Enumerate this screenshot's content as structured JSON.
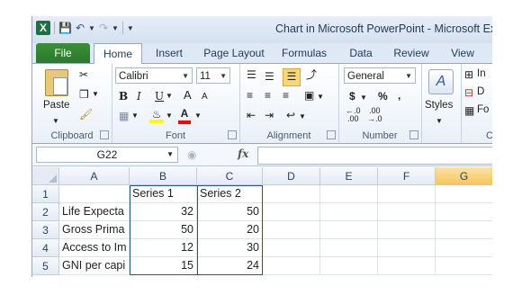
{
  "window": {
    "title": "Chart in Microsoft PowerPoint - Microsoft Excel",
    "app_logo": "X"
  },
  "quick_access": {
    "save_icon": "save-icon",
    "undo_icon": "undo-icon",
    "redo_icon": "redo-icon",
    "customize_icon": "customize-qat-icon"
  },
  "tabs": [
    {
      "label": "File"
    },
    {
      "label": "Home"
    },
    {
      "label": "Insert"
    },
    {
      "label": "Page Layout"
    },
    {
      "label": "Formulas"
    },
    {
      "label": "Data"
    },
    {
      "label": "Review"
    },
    {
      "label": "View"
    }
  ],
  "ribbon": {
    "clipboard": {
      "label": "Clipboard",
      "paste": "Paste"
    },
    "font": {
      "label": "Font",
      "name": "Calibri",
      "size": "11",
      "bold": "B",
      "italic": "I",
      "underline": "U",
      "grow": "A",
      "shrink": "A",
      "color_letter": "A",
      "fill_color": "#ffff00",
      "font_color": "#ff0000"
    },
    "alignment": {
      "label": "Alignment"
    },
    "number": {
      "label": "Number",
      "format": "General",
      "currency": "$",
      "percent": "%",
      "comma": ","
    },
    "styles": {
      "label": "Styles"
    },
    "cells": {
      "insert": "In",
      "delete": "D",
      "format": "Fo",
      "label": "C"
    }
  },
  "formula_bar": {
    "name_box": "G22",
    "fx": "fx",
    "formula": ""
  },
  "sheet": {
    "columns": [
      "A",
      "B",
      "C",
      "D",
      "E",
      "F",
      "G"
    ],
    "selected_column": "G",
    "rows": [
      {
        "num": "1",
        "a": "",
        "b": "Series 1",
        "c": "Series 2"
      },
      {
        "num": "2",
        "a": "Life Expecta",
        "b": "32",
        "c": "50"
      },
      {
        "num": "3",
        "a": "Gross Prima",
        "b": "50",
        "c": "20"
      },
      {
        "num": "4",
        "a": "Access to Im",
        "b": "12",
        "c": "30"
      },
      {
        "num": "5",
        "a": "GNI per capi",
        "b": "15",
        "c": "24"
      }
    ]
  }
}
